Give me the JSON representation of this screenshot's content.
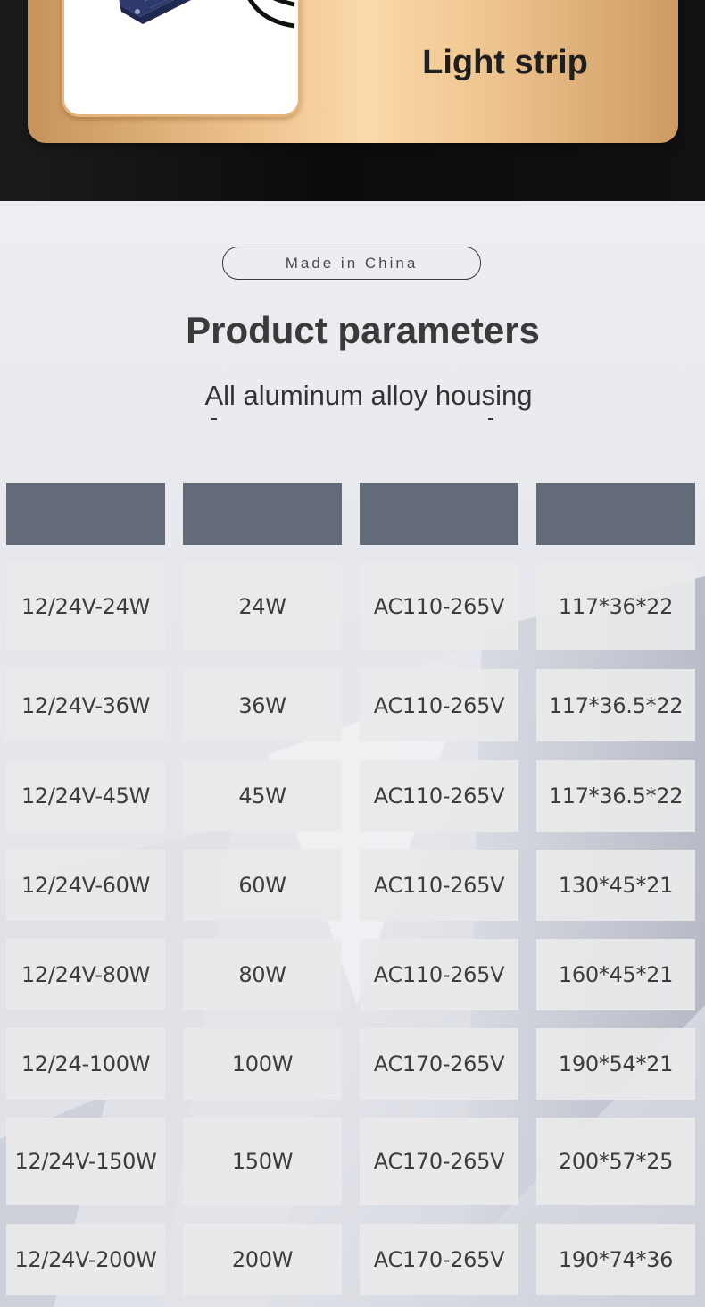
{
  "banner": {
    "title": "Light strip"
  },
  "badge": {
    "text": "Made in China"
  },
  "section": {
    "title": "Product parameters",
    "subtitle": "All aluminum alloy housing"
  },
  "table": {
    "headers": [
      "",
      "",
      "",
      ""
    ],
    "rows": [
      [
        "12/24V-24W",
        "24W",
        "AC110-265V",
        "117*36*22"
      ],
      [
        "12/24V-36W",
        "36W",
        "AC110-265V",
        "117*36.5*22"
      ],
      [
        "12/24V-45W",
        "45W",
        "AC110-265V",
        "117*36.5*22"
      ],
      [
        "12/24V-60W",
        "60W",
        "AC110-265V",
        "130*45*21"
      ],
      [
        "12/24V-80W",
        "80W",
        "AC110-265V",
        "160*45*21"
      ],
      [
        "12/24-100W",
        "100W",
        "AC170-265V",
        "190*54*21"
      ],
      [
        "12/24V-150W",
        "150W",
        "AC170-265V",
        "200*57*25"
      ],
      [
        "12/24V-200W",
        "200W",
        "AC170-265V",
        "190*74*36"
      ]
    ]
  },
  "colors": {
    "header_cell": "#646b78",
    "gold": "#fbd9a9",
    "dark_band": "#0c0c0c"
  }
}
